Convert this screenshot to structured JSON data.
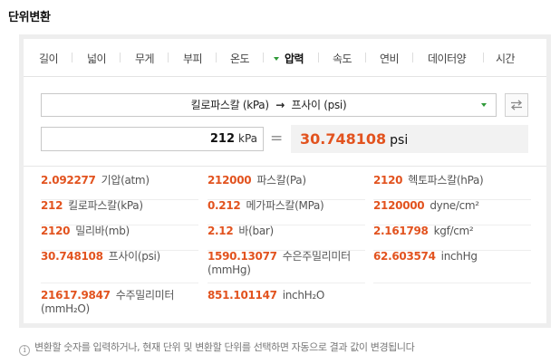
{
  "title": "단위변환",
  "tabs": [
    {
      "label": "길이"
    },
    {
      "label": "넓이"
    },
    {
      "label": "무게"
    },
    {
      "label": "부피"
    },
    {
      "label": "온도"
    },
    {
      "label": "압력",
      "active": true
    },
    {
      "label": "속도"
    },
    {
      "label": "연비"
    },
    {
      "label": "데이터양"
    },
    {
      "label": "시간"
    }
  ],
  "converter": {
    "from_unit": "킬로파스칼 (kPa)",
    "arrow": "→",
    "to_unit": "프사이 (psi)",
    "input_value": "212",
    "input_unit": "kPa",
    "equals": "=",
    "result_value": "30.748108",
    "result_unit": "psi"
  },
  "results": [
    {
      "value": "2.092277",
      "label": "기압(atm)"
    },
    {
      "value": "212000",
      "label": "파스칼(Pa)"
    },
    {
      "value": "2120",
      "label": "헥토파스칼(hPa)"
    },
    {
      "value": "212",
      "label": "킬로파스칼(kPa)"
    },
    {
      "value": "0.212",
      "label": "메가파스칼(MPa)"
    },
    {
      "value": "2120000",
      "label": "dyne/cm²"
    },
    {
      "value": "2120",
      "label": "밀리바(mb)"
    },
    {
      "value": "2.12",
      "label": "바(bar)"
    },
    {
      "value": "2.161798",
      "label": "kgf/cm²"
    },
    {
      "value": "30.748108",
      "label": "프사이(psi)"
    },
    {
      "value": "1590.13077",
      "label": "수은주밀리미터(mmHg)"
    },
    {
      "value": "62.603574",
      "label": "inchHg"
    },
    {
      "value": "21617.9847",
      "label": "수주밀리미터(mmH₂O)"
    },
    {
      "value": "851.101147",
      "label": "inchH₂O"
    }
  ],
  "notice": "변환할 숫자를 입력하거나, 현재 단위 및 변환할 단위를 선택하면 자동으로 결과 값이 변경됩니다",
  "colors": {
    "accent": "#e2531f",
    "tab_marker": "#2f9a38",
    "panel_border": "#eeeeee"
  }
}
